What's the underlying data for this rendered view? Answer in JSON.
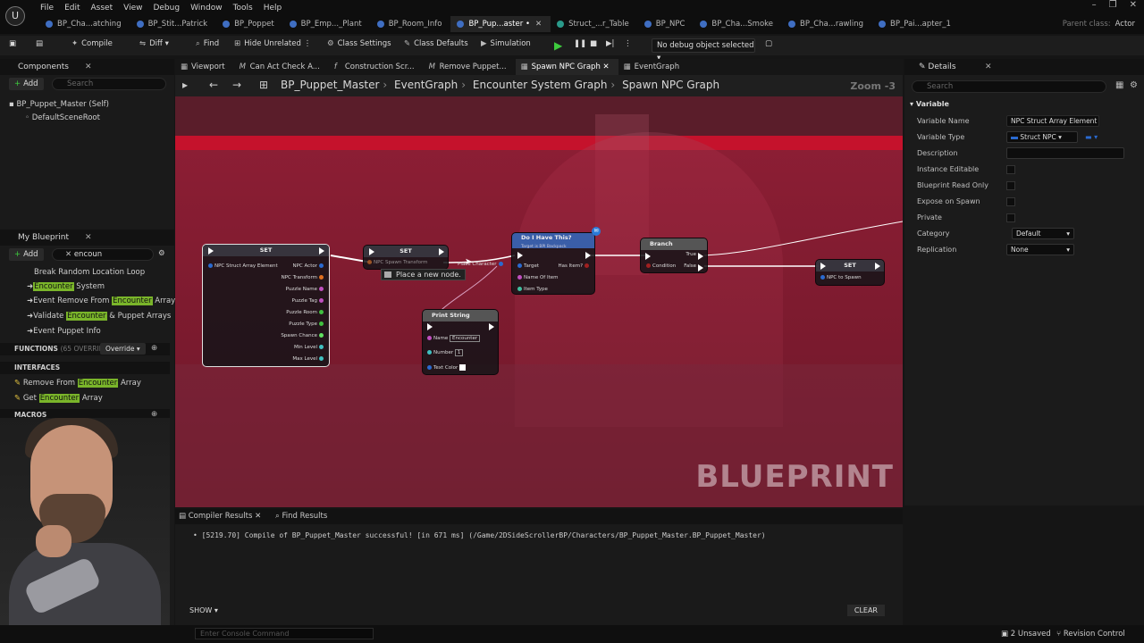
{
  "menu": [
    "File",
    "Edit",
    "Asset",
    "View",
    "Debug",
    "Window",
    "Tools",
    "Help"
  ],
  "doc_tabs": [
    {
      "label": "BP_Cha...atching",
      "active": false
    },
    {
      "label": "BP_Stit...Patrick",
      "active": false
    },
    {
      "label": "BP_Poppet",
      "active": false
    },
    {
      "label": "BP_Emp..._Plant",
      "active": false
    },
    {
      "label": "BP_Room_Info",
      "active": false
    },
    {
      "label": "BP_Pup...aster",
      "active": true,
      "suffix": "•"
    },
    {
      "label": "Struct_...r_Table",
      "active": false
    },
    {
      "label": "BP_NPC",
      "active": false
    },
    {
      "label": "BP_Cha...Smoke",
      "active": false
    },
    {
      "label": "BP_Cha...rawling",
      "active": false
    },
    {
      "label": "BP_Pai...apter_1",
      "active": false
    }
  ],
  "parent_class": {
    "label": "Parent class:",
    "value": "Actor"
  },
  "toolbar": {
    "compile": "Compile",
    "diff": "Diff",
    "find": "Find",
    "hide_unrelated": "Hide Unrelated",
    "class_settings": "Class Settings",
    "class_defaults": "Class Defaults",
    "simulation": "Simulation",
    "debug_object": "No debug object selected"
  },
  "components": {
    "title": "Components",
    "add": "Add",
    "search_placeholder": "Search",
    "items": [
      "BP_Puppet_Master (Self)",
      "DefaultSceneRoot"
    ]
  },
  "my_blueprint": {
    "title": "My Blueprint",
    "add": "Add",
    "search_value": "encoun",
    "events": [
      {
        "pre": "Break Random Location Loop",
        "hl": "",
        "post": ""
      },
      {
        "pre": "",
        "hl": "Encounter",
        "post": " System"
      },
      {
        "pre": "Event Remove From ",
        "hl": "Encounter",
        "post": " Array"
      },
      {
        "pre": "Validate ",
        "hl": "Encounter",
        "post": " & Puppet Arrays"
      },
      {
        "pre": "Event Puppet Info",
        "hl": "",
        "post": ""
      }
    ],
    "functions_label": "FUNCTIONS",
    "functions_sub": "(65 OVERRIDABLE)",
    "override": "Override",
    "interfaces_label": "INTERFACES",
    "interfaces": [
      {
        "pre": "Remove From ",
        "hl": "Encounter",
        "post": " Array"
      },
      {
        "pre": "Get ",
        "hl": "Encounter",
        "post": " Array"
      }
    ],
    "macros_label": "MACROS"
  },
  "graph_tabs": [
    {
      "label": "Viewport",
      "active": false
    },
    {
      "label": "Can Act Check A...",
      "active": false
    },
    {
      "label": "Construction Scr...",
      "active": false
    },
    {
      "label": "Remove Puppet...",
      "active": false
    },
    {
      "label": "Spawn NPC Graph",
      "active": true
    },
    {
      "label": "EventGraph",
      "active": false
    }
  ],
  "breadcrumb": [
    "BP_Puppet_Master",
    "EventGraph",
    "Encounter System Graph",
    "Spawn NPC Graph"
  ],
  "zoom": "Zoom -3",
  "watermark": "BLUEPRINT",
  "tooltip": "Place a new node.",
  "nodes": {
    "set1": {
      "title": "SET",
      "pins": [
        "NPC Struct Array Element",
        "NPC Actor",
        "NPC Transform",
        "Puzzle Name",
        "Puzzle Tag",
        "Puzzle Room",
        "Puzzle Type",
        "Spawn Chance",
        "Min Level",
        "Max Level"
      ]
    },
    "set2": {
      "title": "SET",
      "pins": [
        "NPC Spawn Transform",
        "Place Character"
      ]
    },
    "do_i_have": {
      "title": "Do I Have This?",
      "subtitle": "Target is BPI Backpack",
      "pins": [
        "Target",
        "Has Item?",
        "Name Of Item",
        "Item Type"
      ]
    },
    "branch": {
      "title": "Branch",
      "pins": [
        "Condition",
        "True",
        "False"
      ]
    },
    "set3": {
      "title": "SET",
      "pins": [
        "NPC to Spawn"
      ]
    },
    "print": {
      "title": "Print String",
      "pins": [
        "Name",
        "Number",
        "Text Color"
      ],
      "name_value": "Encounter",
      "number_value": "1"
    }
  },
  "details": {
    "title": "Details",
    "search_placeholder": "Search",
    "section": "Variable",
    "rows": [
      {
        "label": "Variable Name",
        "value": "NPC Struct Array Element"
      },
      {
        "label": "Variable Type",
        "value": "Struct NPC"
      },
      {
        "label": "Description",
        "value": ""
      },
      {
        "label": "Instance Editable",
        "value": ""
      },
      {
        "label": "Blueprint Read Only",
        "value": ""
      },
      {
        "label": "Expose on Spawn",
        "value": ""
      },
      {
        "label": "Private",
        "value": ""
      },
      {
        "label": "Category",
        "value": "Default"
      },
      {
        "label": "Replication",
        "value": "None"
      }
    ]
  },
  "output": {
    "tab_compiler": "Compiler Results",
    "tab_find": "Find Results",
    "message": "[5219.70] Compile of BP_Puppet_Master successful! [in 671 ms] (/Game/2DSideScrollerBP/Characters/BP_Puppet_Master.BP_Puppet_Master)",
    "show": "SHOW",
    "clear": "CLEAR"
  },
  "status": {
    "console_placeholder": "Enter Console Command",
    "unsaved": "2 Unsaved",
    "revision": "Revision Control"
  },
  "colors": {
    "accent_green": "#3ecb3e",
    "highlight": "#7ab52a",
    "canvas_red": "#c5122c"
  }
}
